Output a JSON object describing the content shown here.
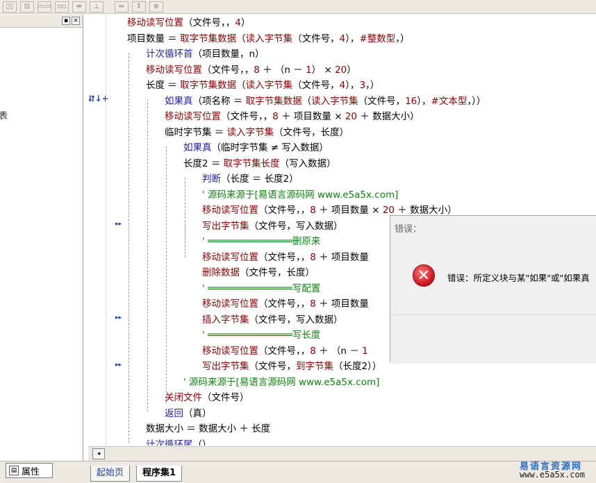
{
  "toolbar": {
    "buttons": [
      "▯▯",
      "⊟",
      "▭▭",
      "▫▫",
      "⇹",
      "⊥",
      "⇔",
      "⇕",
      "⊕"
    ]
  },
  "left_panel": {
    "pin": "▪",
    "close": "×",
    "fragment": "表"
  },
  "gutter": {
    "marks": [
      "⮃↓+",
      "▸▸",
      "▸▸",
      "▸▸"
    ]
  },
  "code_lines": [
    {
      "indent": 0,
      "parts": [
        {
          "t": "移动读写位置",
          "c": "kw"
        },
        {
          "t": "（文件号，，",
          "c": ""
        },
        {
          "t": "4",
          "c": "num"
        },
        {
          "t": "）",
          "c": ""
        }
      ]
    },
    {
      "indent": 0,
      "parts": [
        {
          "t": "项目数量 ＝ ",
          "c": ""
        },
        {
          "t": "取字节集数据",
          "c": "kw"
        },
        {
          "t": "（",
          "c": ""
        },
        {
          "t": "读入字节集",
          "c": "kw"
        },
        {
          "t": "（文件号，",
          "c": ""
        },
        {
          "t": "4",
          "c": "num"
        },
        {
          "t": "），",
          "c": ""
        },
        {
          "t": "#整数型",
          "c": "kw"
        },
        {
          "t": "，）",
          "c": ""
        }
      ]
    },
    {
      "indent": 1,
      "parts": [
        {
          "t": "计次循环首",
          "c": "ct"
        },
        {
          "t": "（项目数量，n）",
          "c": ""
        }
      ]
    },
    {
      "indent": 1,
      "parts": [
        {
          "t": "移动读写位置",
          "c": "kw"
        },
        {
          "t": "（文件号，，",
          "c": ""
        },
        {
          "t": "8",
          "c": "num"
        },
        {
          "t": " ＋ （n － ",
          "c": ""
        },
        {
          "t": "1",
          "c": "num"
        },
        {
          "t": "） × ",
          "c": ""
        },
        {
          "t": "20",
          "c": "num"
        },
        {
          "t": "）",
          "c": ""
        }
      ]
    },
    {
      "indent": 1,
      "parts": [
        {
          "t": "长度 ＝ ",
          "c": ""
        },
        {
          "t": "取字节集数据",
          "c": "kw"
        },
        {
          "t": "（",
          "c": ""
        },
        {
          "t": "读入字节集",
          "c": "kw"
        },
        {
          "t": "（文件号，",
          "c": ""
        },
        {
          "t": "4",
          "c": "num"
        },
        {
          "t": "），",
          "c": ""
        },
        {
          "t": "3",
          "c": "num"
        },
        {
          "t": "，）",
          "c": ""
        }
      ]
    },
    {
      "indent": 2,
      "parts": [
        {
          "t": "如果真",
          "c": "ct"
        },
        {
          "t": "（项名称 ＝ ",
          "c": ""
        },
        {
          "t": "取字节集数据",
          "c": "kw"
        },
        {
          "t": "（",
          "c": ""
        },
        {
          "t": "读入字节集",
          "c": "kw"
        },
        {
          "t": "（文件号，",
          "c": ""
        },
        {
          "t": "16",
          "c": "num"
        },
        {
          "t": "），",
          "c": ""
        },
        {
          "t": "#文本型",
          "c": "kw"
        },
        {
          "t": "，））",
          "c": ""
        }
      ]
    },
    {
      "indent": 2,
      "parts": [
        {
          "t": "移动读写位置",
          "c": "kw"
        },
        {
          "t": "（文件号，，",
          "c": ""
        },
        {
          "t": "8",
          "c": "num"
        },
        {
          "t": " ＋ 项目数量 × ",
          "c": ""
        },
        {
          "t": "20",
          "c": "num"
        },
        {
          "t": " ＋ 数据大小）",
          "c": ""
        }
      ]
    },
    {
      "indent": 2,
      "parts": [
        {
          "t": "临时字节集 ＝ ",
          "c": ""
        },
        {
          "t": "读入字节集",
          "c": "kw"
        },
        {
          "t": "（文件号，长度）",
          "c": ""
        }
      ]
    },
    {
      "indent": 3,
      "parts": [
        {
          "t": "如果真",
          "c": "ct"
        },
        {
          "t": "（临时字节集 ≠ 写入数据）",
          "c": ""
        }
      ]
    },
    {
      "indent": 3,
      "parts": [
        {
          "t": "长度2 ＝ ",
          "c": ""
        },
        {
          "t": "取字节集长度",
          "c": "kw"
        },
        {
          "t": "（写入数据）",
          "c": ""
        }
      ]
    },
    {
      "indent": 4,
      "parts": [
        {
          "t": "判断",
          "c": "ct"
        },
        {
          "t": "（长度 ＝ 长度2）",
          "c": ""
        }
      ]
    },
    {
      "indent": 4,
      "parts": [
        {
          "t": "' 源码来源于[易语言源码网 www.e5a5x.com]",
          "c": "cm"
        }
      ]
    },
    {
      "indent": 4,
      "parts": [
        {
          "t": "移动读写位置",
          "c": "kw"
        },
        {
          "t": "（文件号，，",
          "c": ""
        },
        {
          "t": "8",
          "c": "num"
        },
        {
          "t": " ＋ 项目数量 × ",
          "c": ""
        },
        {
          "t": "20",
          "c": "num"
        },
        {
          "t": " ＋ 数据大小）",
          "c": ""
        }
      ]
    },
    {
      "indent": 4,
      "parts": [
        {
          "t": "写出字节集",
          "c": "kw"
        },
        {
          "t": "（文件号，写入数据）",
          "c": ""
        }
      ]
    },
    {
      "indent": 4,
      "parts": [
        {
          "t": "' ═══════════════删原来",
          "c": "cm"
        }
      ]
    },
    {
      "indent": 4,
      "parts": [
        {
          "t": "移动读写位置",
          "c": "kw"
        },
        {
          "t": "（文件号，，",
          "c": ""
        },
        {
          "t": "8",
          "c": "num"
        },
        {
          "t": " ＋ 项目数量",
          "c": ""
        }
      ]
    },
    {
      "indent": 4,
      "parts": [
        {
          "t": "删除数据",
          "c": "kw"
        },
        {
          "t": "（文件号，长度）",
          "c": ""
        }
      ]
    },
    {
      "indent": 4,
      "parts": [
        {
          "t": "' ═══════════════写配置",
          "c": "cm"
        }
      ]
    },
    {
      "indent": 4,
      "parts": [
        {
          "t": "移动读写位置",
          "c": "kw"
        },
        {
          "t": "（文件号，，",
          "c": ""
        },
        {
          "t": "8",
          "c": "num"
        },
        {
          "t": " ＋ 项目数量",
          "c": ""
        }
      ]
    },
    {
      "indent": 4,
      "parts": [
        {
          "t": "插入字节集",
          "c": "kw"
        },
        {
          "t": "（文件号，写入数据）",
          "c": ""
        }
      ]
    },
    {
      "indent": 4,
      "parts": [
        {
          "t": "' ═══════════════写长度",
          "c": "cm"
        }
      ]
    },
    {
      "indent": 4,
      "parts": [
        {
          "t": "移动读写位置",
          "c": "kw"
        },
        {
          "t": "（文件号，，",
          "c": ""
        },
        {
          "t": "8",
          "c": "num"
        },
        {
          "t": " ＋ （n － ",
          "c": ""
        },
        {
          "t": "1",
          "c": "num"
        }
      ]
    },
    {
      "indent": 4,
      "parts": [
        {
          "t": "写出字节集",
          "c": "kw"
        },
        {
          "t": "（文件号，",
          "c": ""
        },
        {
          "t": "到字节集",
          "c": "kw"
        },
        {
          "t": "（长度2））",
          "c": ""
        }
      ]
    },
    {
      "indent": 3,
      "parts": [
        {
          "t": "' 源码来源于[易语言源码网 www.e5a5x.com]",
          "c": "cm"
        }
      ]
    },
    {
      "indent": 2,
      "parts": [
        {
          "t": "关闭文件",
          "c": "kw"
        },
        {
          "t": "（文件号）",
          "c": ""
        }
      ]
    },
    {
      "indent": 2,
      "parts": [
        {
          "t": "返回",
          "c": "ct"
        },
        {
          "t": "（真）",
          "c": ""
        }
      ]
    },
    {
      "indent": 1,
      "parts": [
        {
          "t": "数据大小 ＝ 数据大小 ＋ 长度",
          "c": ""
        }
      ]
    },
    {
      "indent": 1,
      "parts": [
        {
          "t": "计次循环尾",
          "c": "ct"
        },
        {
          "t": "（）",
          "c": ""
        }
      ]
    }
  ],
  "dialog": {
    "title": "错误：",
    "icon": "✕",
    "message": "错误：所定义块与某\"如果\"或\"如果真"
  },
  "scroll": {
    "left_arrow": "◂"
  },
  "bottom": {
    "properties_icon": "▤",
    "properties_label": "属性",
    "tabs": [
      "起始页",
      "程序集1"
    ],
    "brand": "易语言资源网",
    "brand_url": "www.e5a5x.com"
  },
  "colors": {
    "keyword": "#8b0000",
    "control": "#1f1fa8",
    "comment": "#108010",
    "error_icon": "#c8101a"
  }
}
